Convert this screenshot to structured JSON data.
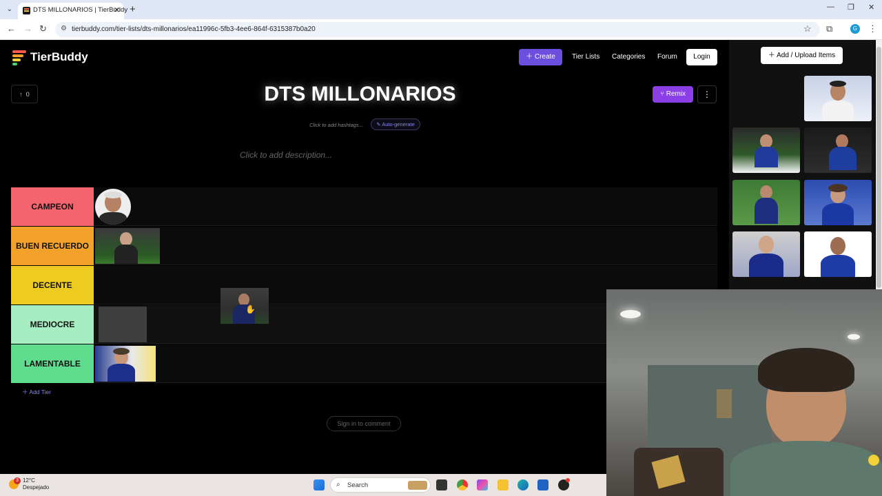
{
  "browser": {
    "tab_title": "DTS MILLONARIOS | TierBuddy",
    "url": "tierbuddy.com/tier-lists/dts-millonarios/ea11996c-5fb3-4ee6-864f-6315387b0a20",
    "profile_initial": "G"
  },
  "site": {
    "brand": "TierBuddy",
    "nav": {
      "create": "Create",
      "tier_lists": "Tier Lists",
      "categories": "Categories",
      "forum": "Forum",
      "login": "Login"
    }
  },
  "list": {
    "title": "DTS MILLONARIOS",
    "upvotes": "0",
    "remix": "Remix",
    "hashtags_placeholder": "Click to add hashtags...",
    "autogenerate": "Auto-generate",
    "description_placeholder": "Click to add description...",
    "add_tier": "Add Tier",
    "comment_prompt": "Sign in to comment"
  },
  "tiers": [
    {
      "label": "CAMPEON",
      "color": "#f4646e"
    },
    {
      "label": "BUEN RECUERDO",
      "color": "#f2a22b"
    },
    {
      "label": "DECENTE",
      "color": "#eecb21"
    },
    {
      "label": "MEDIOCRE",
      "color": "#a7edc2"
    },
    {
      "label": "LAMENTABLE",
      "color": "#5fdc8e"
    }
  ],
  "panel": {
    "upload_button": "Add / Upload Items"
  },
  "taskbar": {
    "temperature": "12°C",
    "condition": "Despejado",
    "search": "Search",
    "notification_count": "3"
  }
}
